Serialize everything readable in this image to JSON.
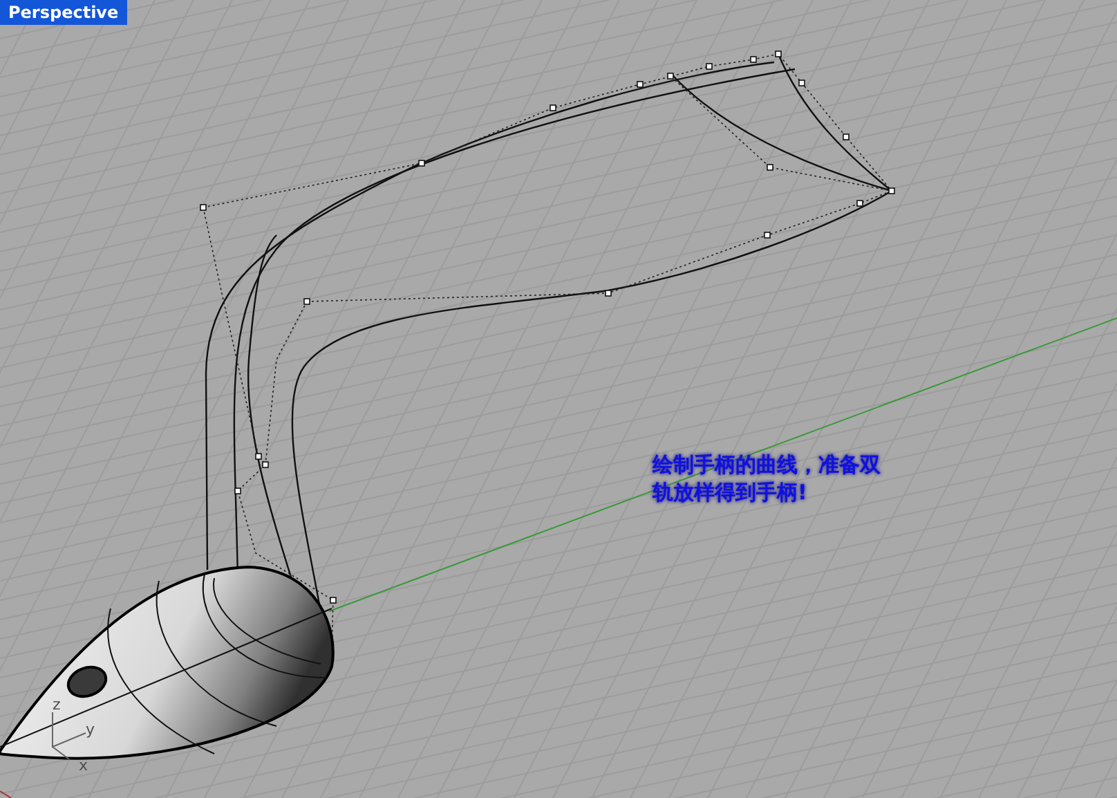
{
  "viewport": {
    "title": "Perspective"
  },
  "annotation": {
    "lines": [
      "绘制手柄的曲线，准备双",
      "轨放样得到手柄!"
    ]
  },
  "axes": {
    "z": "z",
    "y": "y",
    "x": "x"
  }
}
